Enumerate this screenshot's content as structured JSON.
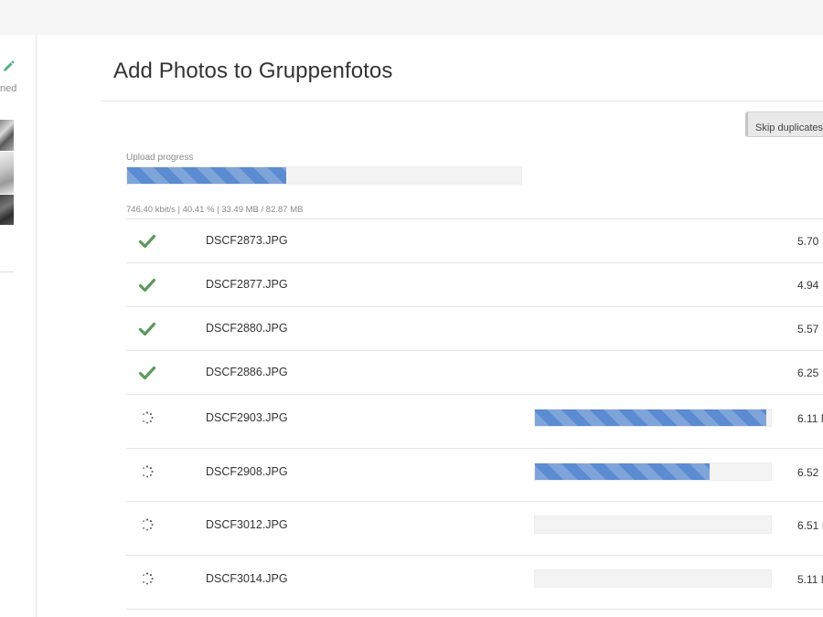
{
  "page": {
    "title": "Add Photos to Gruppenfotos"
  },
  "sidebar_partial": {
    "edit_icon": "pencil-icon",
    "truncated_label": "ned"
  },
  "toolbar": {
    "skip_duplicates_label": "Skip duplicates"
  },
  "upload": {
    "label": "Upload progress",
    "percent": 40.41,
    "stats": "746.40 kbit/s | 40.41 % | 33.49 MB / 82.87 MB"
  },
  "colors": {
    "progress_blue": "#5b8bd0",
    "check_green": "#5c9a5c"
  },
  "files": [
    {
      "name": "DSCF2873.JPG",
      "size": "5.70",
      "status": "done",
      "status_icon": "check-icon"
    },
    {
      "name": "DSCF2877.JPG",
      "size": "4.94",
      "status": "done",
      "status_icon": "check-icon"
    },
    {
      "name": "DSCF2880.JPG",
      "size": "5.57",
      "status": "done",
      "status_icon": "check-icon"
    },
    {
      "name": "DSCF2886.JPG",
      "size": "6.25",
      "status": "done",
      "status_icon": "check-icon"
    },
    {
      "name": "DSCF2903.JPG",
      "size": "6.11 M",
      "status": "uploading",
      "status_icon": "spinner-icon",
      "progress": 0.98
    },
    {
      "name": "DSCF2908.JPG",
      "size": "6.52",
      "status": "uploading",
      "status_icon": "spinner-icon",
      "progress": 0.74
    },
    {
      "name": "DSCF3012.JPG",
      "size": "6.51 I",
      "status": "queued",
      "status_icon": "spinner-icon",
      "progress": 0
    },
    {
      "name": "DSCF3014.JPG",
      "size": "5.11 M",
      "status": "queued",
      "status_icon": "spinner-icon",
      "progress": 0
    }
  ]
}
